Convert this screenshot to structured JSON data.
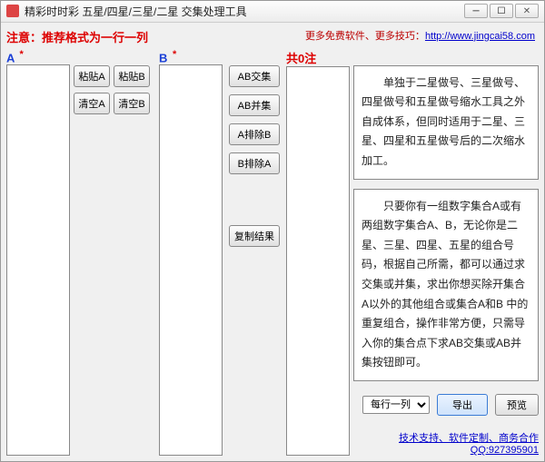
{
  "window": {
    "title": "精彩时时彩 五星/四星/三星/二星 交集处理工具"
  },
  "notice": "注意：推荐格式为一行一列",
  "topLink": {
    "prefix": "更多免费软件、更多技巧：",
    "url": "http://www.jingcai58.com"
  },
  "labels": {
    "a": "A",
    "b": "B",
    "star": "*",
    "resultPrefix": "共",
    "resultCount": "0",
    "resultSuffix": "注"
  },
  "buttons": {
    "pasteA": "粘贴A",
    "pasteB": "粘贴B",
    "clearA": "清空A",
    "clearB": "清空B",
    "abIntersect": "AB交集",
    "abUnion": "AB并集",
    "aExcludeB": "A排除B",
    "bExcludeA": "B排除A",
    "copyResult": "复制结果",
    "export": "导出",
    "preview": "预览"
  },
  "select": {
    "value": "每行一列"
  },
  "info1": "单独于二星做号、三星做号、四星做号和五星做号缩水工具之外自成体系，但同时适用于二星、三星、四星和五星做号后的二次缩水加工。",
  "info2": "只要你有一组数字集合A或有两组数字集合A、B，无论你是二星、三星、四星、五星的组合号码，根据自己所需，都可以通过求交集或并集，求出你想买除开集合A以外的其他组合或集合A和B 中的重复组合，操作非常方便，只需导入你的集合点下求AB交集或AB并集按钮即可。",
  "footer": "技术支持、软件定制、商务合作QQ:927395901"
}
